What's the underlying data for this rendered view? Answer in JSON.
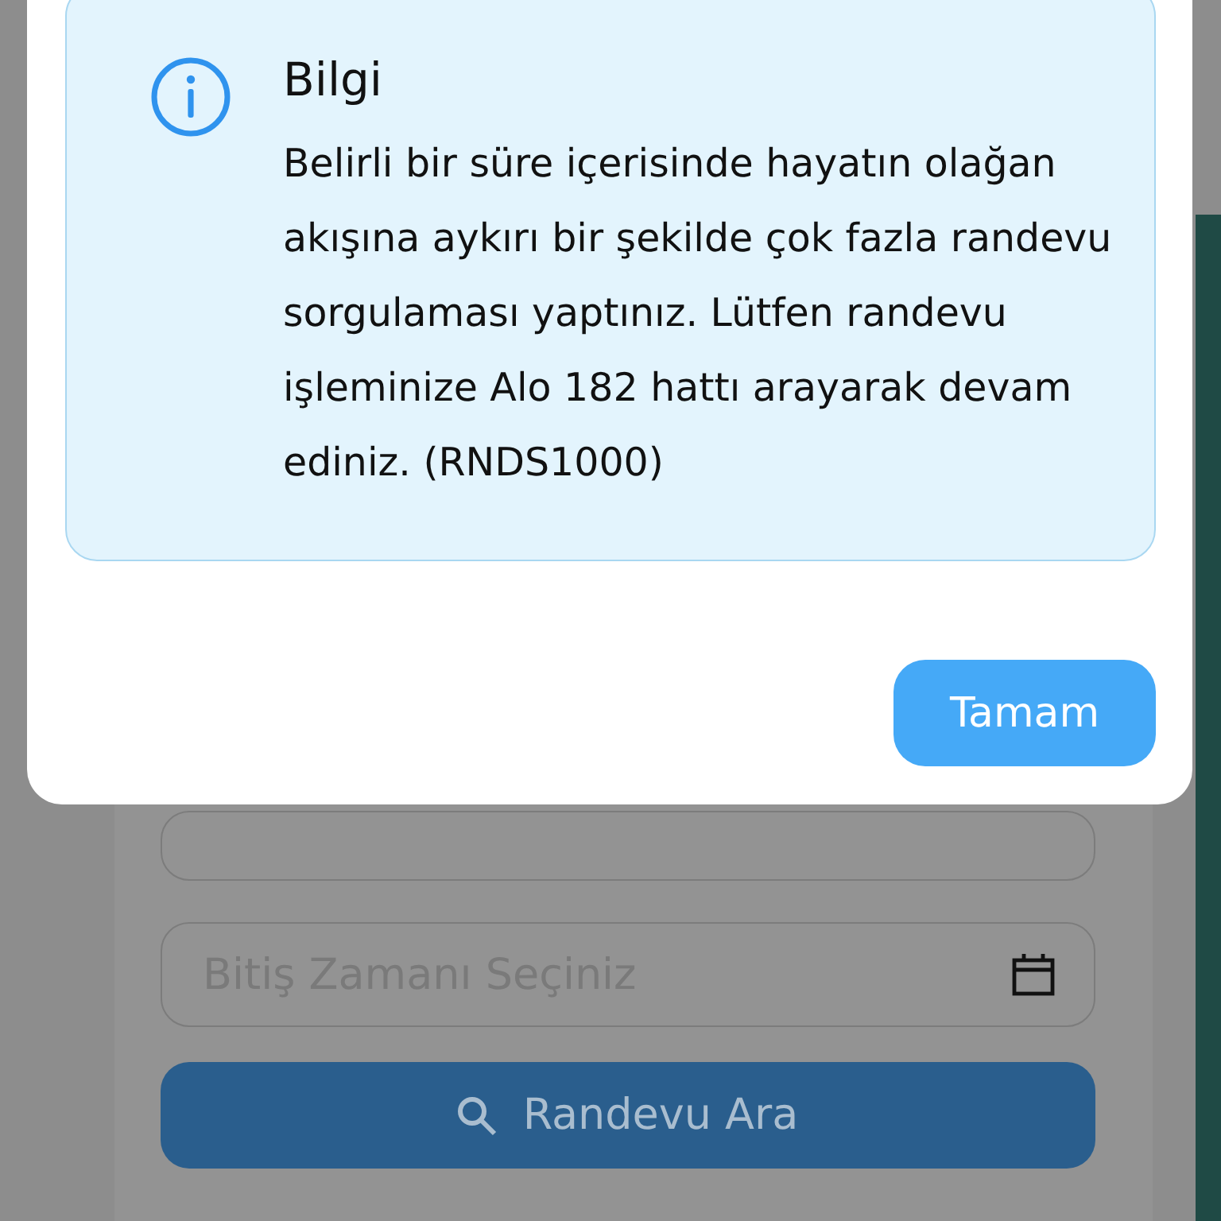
{
  "form": {
    "date_field": {
      "placeholder": "Bitiş Zamanı Seçiniz"
    },
    "search_button": "Randevu Ara"
  },
  "dialog": {
    "title": "Bilgi",
    "message": "Belirli bir süre içerisinde hayatın olağan akışına aykırı bir şekilde çok fazla randevu sorgulaması yaptınız. Lütfen randevu işleminize Alo 182 hattı arayarak devam ediniz. (RNDS1000)",
    "button": "Tamam"
  }
}
